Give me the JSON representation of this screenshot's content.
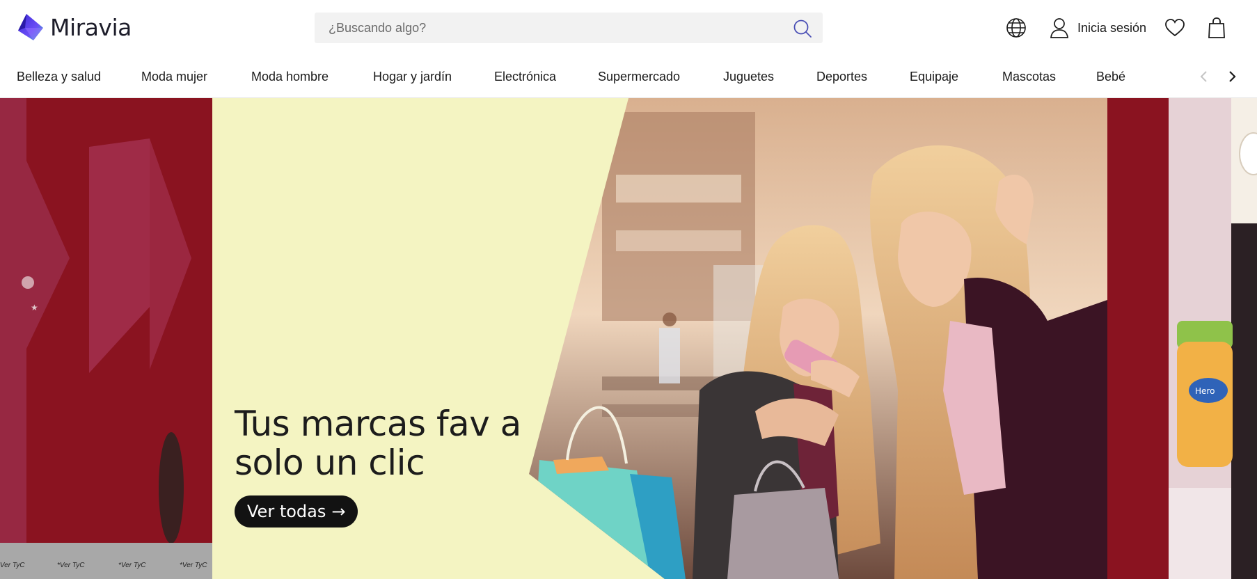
{
  "brand": {
    "name": "Miravia",
    "accent": "#5b3df5"
  },
  "search": {
    "placeholder": "¿Buscando algo?",
    "icon": "search-icon"
  },
  "header": {
    "language_icon": "globe-icon",
    "login_label": "Inicia sesión",
    "login_icon": "user-icon",
    "wishlist_icon": "heart-icon",
    "cart_icon": "shopping-bag-icon"
  },
  "categories": [
    "Belleza y salud",
    "Moda mujer",
    "Moda hombre",
    "Hogar y jardín",
    "Electrónica",
    "Supermercado",
    "Juguetes",
    "Deportes",
    "Equipaje",
    "Mascotas",
    "Bebé"
  ],
  "carousel": {
    "headline_line1": "Tus marcas fav a",
    "headline_line2": "solo un clic",
    "cta_label": "Ver todas",
    "cta_arrow": "→",
    "side_notes": [
      "*Ver TyC",
      "*Ver TyC",
      "*Ver TyC",
      "*Ver TyC"
    ],
    "colors": {
      "banner_bg": "#f4f4c2",
      "side_left": "#8a1320",
      "side_right": "#8a1320"
    }
  }
}
